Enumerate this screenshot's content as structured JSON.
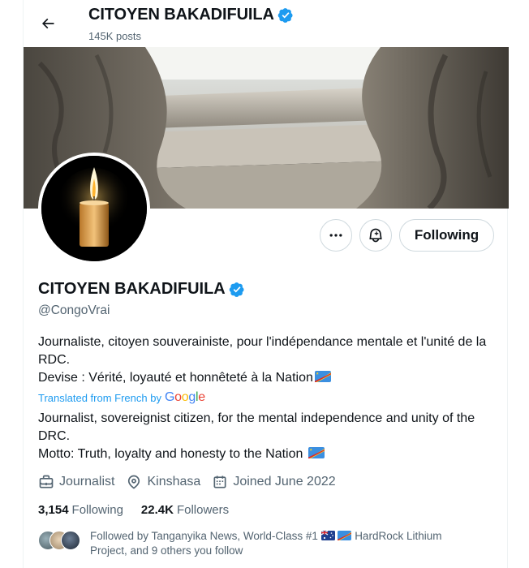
{
  "header": {
    "title": "CITOYEN BAKADIFUILA",
    "posts": "145K posts"
  },
  "actions": {
    "more_label": "More",
    "notify_label": "Notifications",
    "following_label": "Following"
  },
  "profile": {
    "name": "CITOYEN BAKADIFUILA",
    "handle": "@CongoVrai",
    "bio_original_line1": "Journaliste, citoyen souverainiste, pour l'indépendance mentale et l'unité de la RDC.",
    "bio_original_line2": "Devise : Vérité, loyauté et honnêteté à la Nation",
    "translated_label": "Translated from French by",
    "translated_brand": "Google",
    "bio_translated_line1": "Journalist, sovereignist citizen, for the mental independence and unity of the DRC.",
    "bio_translated_line2": "Motto: Truth, loyalty and honesty to the Nation",
    "profession": "Journalist",
    "location": "Kinshasa",
    "joined": "Joined June 2022"
  },
  "stats": {
    "following_count": "3,154",
    "following_label": "Following",
    "followers_count": "22.4K",
    "followers_label": "Followers"
  },
  "followed_by": {
    "prefix": "Followed by Tanganyika News, World-Class #1",
    "suffix": "HardRock Lithium Project, and 9 others you follow"
  },
  "colors": {
    "accent": "#1d9bf0",
    "text": "#0f1419",
    "secondary": "#536471",
    "border": "#cfd9de"
  },
  "icons": [
    "back-arrow-icon",
    "verified-badge-icon",
    "more-dots-icon",
    "bell-plus-icon",
    "briefcase-icon",
    "location-pin-icon",
    "calendar-icon",
    "drc-flag-icon",
    "australia-flag-icon"
  ]
}
